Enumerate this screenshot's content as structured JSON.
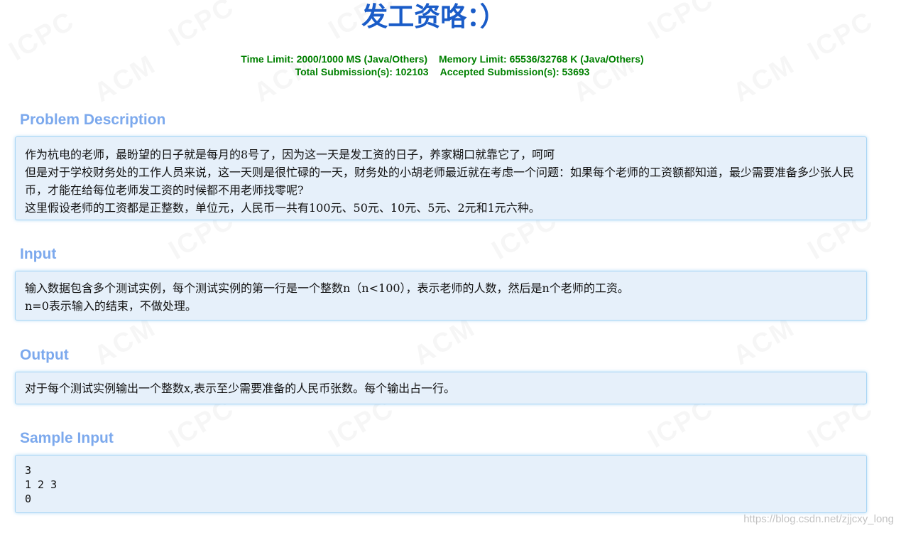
{
  "problem": {
    "title": "发工资咯：）",
    "time_limit": "Time Limit: 2000/1000 MS (Java/Others)",
    "memory_limit": "Memory Limit: 65536/32768 K (Java/Others)",
    "total_submissions": "Total Submission(s): 102103",
    "accepted_submissions": "Accepted Submission(s): 53693"
  },
  "sections": {
    "description": {
      "heading": "Problem Description",
      "lines": [
        "作为杭电的老师，最盼望的日子就是每月的8号了，因为这一天是发工资的日子，养家糊口就靠它了，呵呵",
        "但是对于学校财务处的工作人员来说，这一天则是很忙碌的一天，财务处的小胡老师最近就在考虑一个问题：如果每个老师的工资额都知道，最少需要准备多少张人民币，才能在给每位老师发工资的时候都不用老师找零呢?",
        "这里假设老师的工资都是正整数，单位元，人民币一共有100元、50元、10元、5元、2元和1元六种。"
      ]
    },
    "input": {
      "heading": "Input",
      "lines": [
        "输入数据包含多个测试实例，每个测试实例的第一行是一个整数n（n<100），表示老师的人数，然后是n个老师的工资。",
        "n=0表示输入的结束，不做处理。"
      ]
    },
    "output": {
      "heading": "Output",
      "lines": [
        "对于每个测试实例输出一个整数x,表示至少需要准备的人民币张数。每个输出占一行。"
      ]
    },
    "sample_input": {
      "heading": "Sample Input",
      "lines": [
        "3",
        "1 2 3",
        "0"
      ]
    }
  },
  "watermark": {
    "text_a": "ICPC",
    "text_b": "ACM"
  },
  "credit": "https://blog.csdn.net/zjjcxy_long",
  "colors": {
    "title": "#1a5cc8",
    "limits": "#008000",
    "section_heading": "#7ca9ed",
    "panel_bg": "#e6f0fa",
    "panel_border": "#a9d6f5"
  }
}
